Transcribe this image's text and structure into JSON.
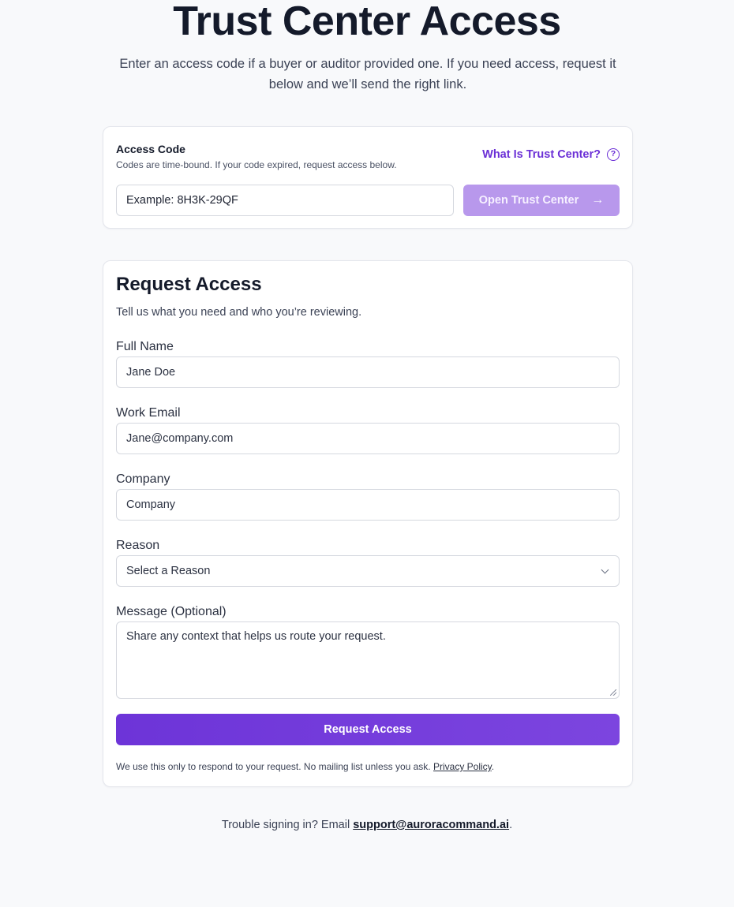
{
  "header": {
    "title": "Trust Center Access",
    "subtitle": "Enter an access code if a buyer or auditor provided one. If you need access, request it below and we’ll send the right link."
  },
  "access_code": {
    "label": "Access Code",
    "help": "Codes are time-bound. If your code expired, request access below.",
    "what_link": "What Is Trust Center?",
    "help_icon_glyph": "?",
    "input_placeholder": "Example: 8H3K-29QF",
    "open_button": "Open Trust Center",
    "arrow_glyph": "→",
    "button_color": "#b898ec",
    "link_color": "#6b2fd6"
  },
  "request": {
    "title": "Request Access",
    "subtitle": "Tell us what you need and who you’re reviewing.",
    "full_name_label": "Full Name",
    "full_name_placeholder": "Jane Doe",
    "email_label": "Work Email",
    "email_placeholder": "Jane@company.com",
    "company_label": "Company",
    "company_placeholder": "Company",
    "reason_label": "Reason",
    "reason_value": "Select a Reason",
    "message_label": "Message (Optional)",
    "message_placeholder": "Share any context that helps us route your request.",
    "submit_button": "Request Access",
    "submit_color": "#6d34d8",
    "disclaimer": "We use this only to respond to your request. No mailing list unless you ask.",
    "privacy_link": "Privacy Policy",
    "disclaimer_end": "."
  },
  "footer": {
    "text": "Trouble signing in? Email",
    "email": "support@auroracommand.ai",
    "end": "."
  }
}
